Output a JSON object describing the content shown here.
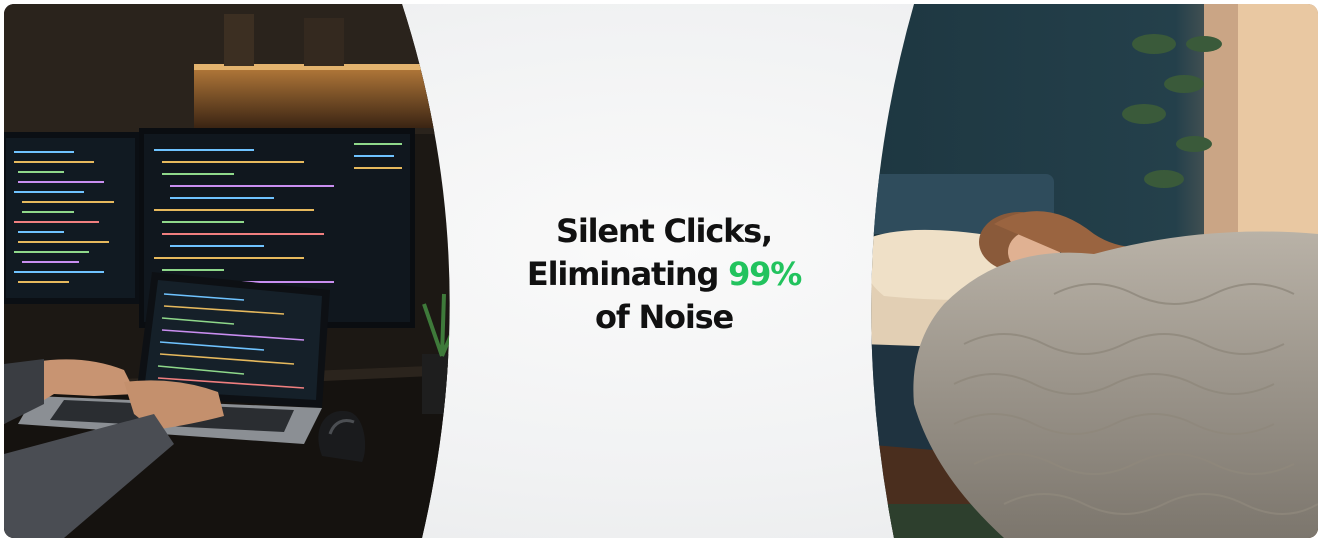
{
  "headline": {
    "line1": "Silent Clicks,",
    "line2_prefix": "Eliminating ",
    "line2_highlight": "99%",
    "line3": "of Noise"
  },
  "colors": {
    "highlight": "#22c35e",
    "headline_text": "#111111",
    "center_background": "#f1f2f3"
  },
  "images": {
    "left": "developer-coding-at-night-with-vertical-mouse-photo",
    "right": "woman-sleeping-in-bed-photo"
  }
}
